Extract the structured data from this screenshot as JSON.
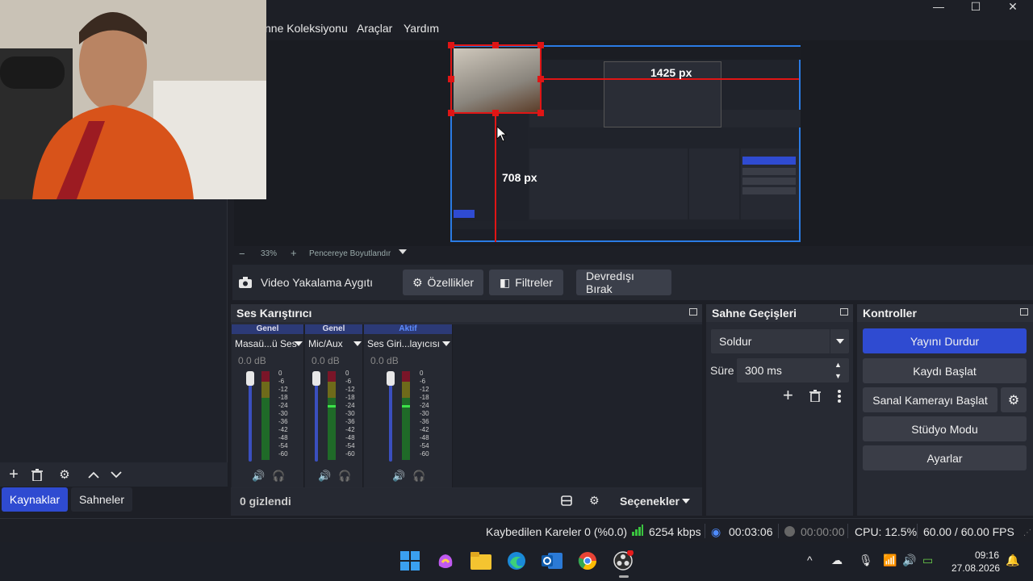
{
  "menu": {
    "items": [
      "nne Koleksiyonu",
      "Araçlar",
      "Yardım"
    ]
  },
  "window_controls": {
    "minimize": "—",
    "maximize": "☐",
    "close": "✕"
  },
  "preview": {
    "width_label": "1425 px",
    "height_label": "708 px"
  },
  "zoom_bar": {
    "minus": "−",
    "zoom": "33%",
    "plus": "+",
    "fit": "Pencereye Boyutlandır"
  },
  "source_bar": {
    "source_name": "Video Yakalama Aygıtı",
    "properties": "Özellikler",
    "filters": "Filtreler",
    "disable": "Devredışı Bırak"
  },
  "left_dock": {
    "tabs": [
      "Kaynaklar",
      "Sahneler"
    ],
    "active_tab": "Kaynaklar"
  },
  "mixer": {
    "title": "Ses Karıştırıcı",
    "channels": [
      {
        "header": "Genel",
        "name": "Masaü...ü Ses",
        "db": "0.0 dB"
      },
      {
        "header": "Genel",
        "name": "Mic/Aux",
        "db": "0.0 dB"
      },
      {
        "header": "Aktif",
        "name": "Ses Giri...layıcısı",
        "db": "0.0 dB"
      }
    ],
    "scale": [
      "0",
      "-6",
      "-12",
      "-18",
      "-24",
      "-30",
      "-36",
      "-42",
      "-48",
      "-54",
      "-60"
    ],
    "hidden_label": "0 gizlendi",
    "options": "Seçenekler"
  },
  "transitions": {
    "title": "Sahne Geçişleri",
    "selected": "Soldur",
    "duration_label": "Süre",
    "duration": "300 ms"
  },
  "controls": {
    "title": "Kontroller",
    "stop_stream": "Yayını Durdur",
    "start_record": "Kaydı Başlat",
    "virtual_cam": "Sanal Kamerayı Başlat",
    "studio_mode": "Stüdyo Modu",
    "settings": "Ayarlar"
  },
  "status": {
    "dropped": "Kaybedilen Kareler 0 (%0.0)",
    "bitrate": "6254 kbps",
    "stream_time": "00:03:06",
    "rec_time": "00:00:00",
    "cpu": "CPU: 12.5%",
    "fps": "60.00 / 60.00 FPS"
  },
  "taskbar": {
    "time": "09:16",
    "date": "27.08.2026"
  },
  "colors": {
    "accent": "#2f4bd1",
    "selection_red": "#e01515",
    "preview_border": "#2a7be4"
  }
}
